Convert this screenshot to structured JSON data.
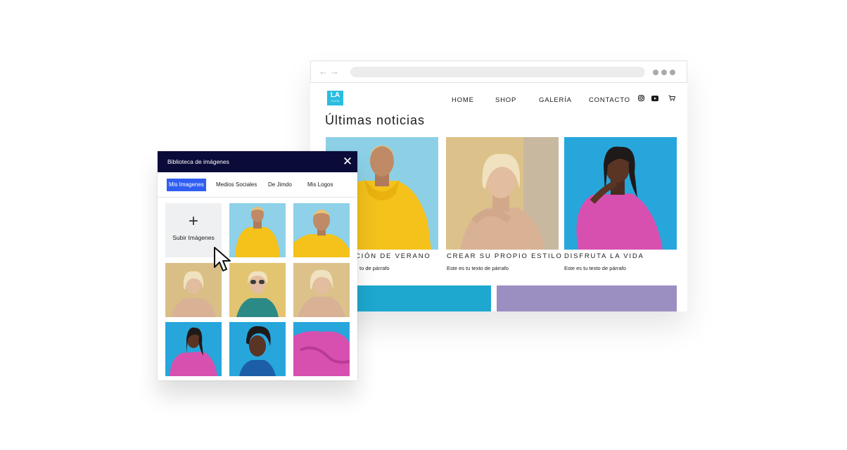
{
  "browser": {
    "nav_back": "←",
    "nav_forward": "→"
  },
  "site": {
    "logo": {
      "big": "LA",
      "small": "TUCH"
    },
    "menu": [
      "HOME",
      "SHOP",
      "GALERÍA",
      "CONTACTO"
    ],
    "social_icons": [
      "instagram-icon",
      "youtube-icon",
      "cart-icon"
    ],
    "section_title": "Últimas noticias",
    "cards": [
      {
        "title": "CIÓN DE VERANO",
        "text": "to de párrafo"
      },
      {
        "title": "CREAR SU PROPIO ESTILO",
        "text": "Este es tu texto de párrafo"
      },
      {
        "title": "DISFRUTA LA VIDA",
        "text": "Este es tu texto de párrafo"
      }
    ],
    "accent_color": "#29bde0"
  },
  "library": {
    "title": "Biblioteca de imágenes",
    "close_glyph": "✕",
    "tabs": [
      "Mis Imagenes",
      "Medios Sociales",
      "De Jimdo",
      "Mis Logos"
    ],
    "active_tab": "Mis Imagenes",
    "upload": {
      "glyph": "+",
      "label": "Subir Imágenes"
    },
    "active_tab_color": "#2f5ef2",
    "header_color": "#0b0b3a"
  }
}
